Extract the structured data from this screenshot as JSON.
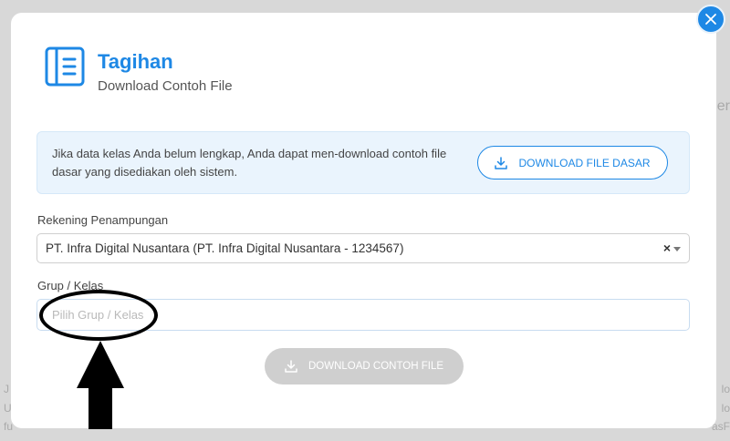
{
  "modal": {
    "title": "Tagihan",
    "subtitle": "Download Contoh File",
    "info_text": "Jika data kelas Anda belum lengkap, Anda dapat men-download contoh file dasar yang disediakan oleh sistem.",
    "download_basic_label": "DOWNLOAD FILE DASAR",
    "account_label": "Rekening Penampungan",
    "account_value": "PT. Infra Digital Nusantara (PT. Infra Digital Nusantara - 1234567)",
    "group_label": "Grup / Kelas",
    "group_placeholder": "Pilih Grup / Kelas",
    "download_sample_label": "DOWNLOAD CONTOH FILE"
  },
  "background": {
    "right_text_1": "er",
    "left_text_1": "J",
    "left_text_2": "U",
    "left_text_3": "fu",
    "right_text_2": "lo",
    "right_text_3": "lo",
    "right_text_4": "asF"
  },
  "colors": {
    "accent": "#1e88e5",
    "disabled": "#cfcfcf",
    "info_bg": "#eaf4fd"
  },
  "icons": {
    "close": "close-icon",
    "header": "document-icon",
    "download": "download-icon"
  }
}
